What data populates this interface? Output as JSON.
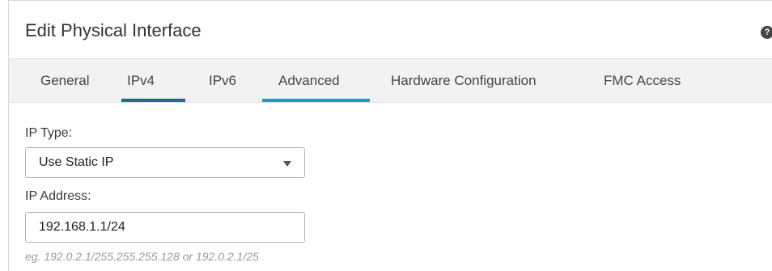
{
  "dialog": {
    "title": "Edit Physical Interface",
    "help_icon": "?"
  },
  "tabs": [
    {
      "label": "General",
      "active": false
    },
    {
      "label": "IPv4",
      "active": true
    },
    {
      "label": "IPv6",
      "active": false
    },
    {
      "label": "Advanced",
      "active": false
    },
    {
      "label": "Hardware Configuration",
      "active": false
    },
    {
      "label": "FMC Access",
      "active": false
    }
  ],
  "form": {
    "ip_type_label": "IP Type:",
    "ip_type_value": "Use Static IP",
    "ip_address_label": "IP Address:",
    "ip_address_value": "192.168.1.1/24",
    "ip_address_hint": "eg. 192.0.2.1/255.255.255.128 or 192.0.2.1/25"
  },
  "colors": {
    "active_tab_underline": "#1b6d95",
    "hover_tab_underline": "#1e9bd7",
    "tabbar_background": "#f2f2f2"
  }
}
